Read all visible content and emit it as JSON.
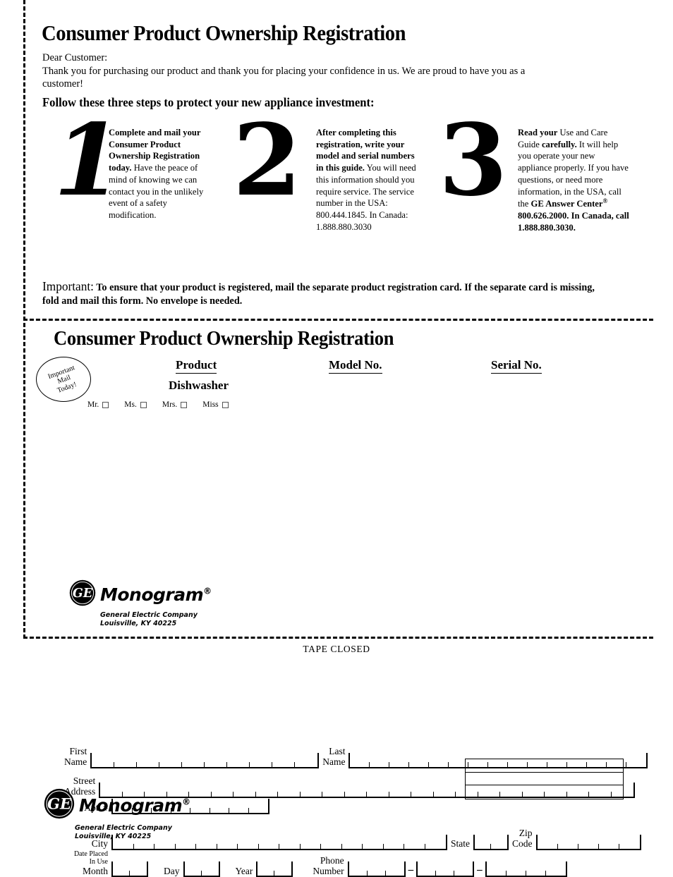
{
  "document": {
    "title": "Consumer Product Ownership Registration",
    "salutation": "Dear Customer:",
    "thank_you": "Thank you for purchasing our product and thank you for placing your confidence in us. We are proud to have you as a customer!",
    "follow_steps_heading": "Follow these three steps to protect your new appliance investment:"
  },
  "steps": [
    {
      "number": "1",
      "bold_text": "Complete and mail your Consumer Product Ownership Registration today.",
      "regular_text": "Have the peace of mind of knowing we can contact you in the unlikely event of a safety modification."
    },
    {
      "number": "2",
      "bold_text": "After completing this registration, write your model and serial numbers in this guide.",
      "regular_text": "You will need this information should you require service. The service number in the USA: 800.444.1845. In Canada: 1.888.880.3030"
    },
    {
      "number": "3",
      "bold_read": "Read your",
      "mid_text_1": " Use and Care Guide ",
      "bold_carefully": "carefully.",
      "mid_text_2": " It will help you operate your new appliance properly. If you have questions, or need more information, in the USA, call the ",
      "bold_answer_center": "GE Answer Center",
      "registered_mark": "®",
      "bold_tail": " 800.626.2000. In Canada, call 1.888.880.3030."
    }
  ],
  "important": {
    "label": "Important:",
    "text": "To ensure that your product is registered, mail the separate product registration card. If the separate card is missing, fold and mail this form. No envelope is needed."
  },
  "card": {
    "title": "Consumer Product Ownership Registration",
    "stamp": {
      "line1": "Important",
      "line2": "Mail",
      "line3": "Today!"
    },
    "headers": {
      "product": "Product",
      "model_no": "Model No.",
      "serial_no": "Serial No."
    },
    "product_value": "Dishwasher",
    "salutations": [
      {
        "label": "Mr.",
        "checked": false
      },
      {
        "label": "Ms.",
        "checked": false
      },
      {
        "label": "Mrs.",
        "checked": false
      },
      {
        "label": "Miss",
        "checked": false
      }
    ],
    "fields": {
      "first_name": {
        "label_line1": "First",
        "label_line2": "Name",
        "cells": 10,
        "value": ""
      },
      "last_name": {
        "label_line1": "Last",
        "label_line2": "Name",
        "cells": 15,
        "value": ""
      },
      "street_address": {
        "label_line1": "Street",
        "label_line2": "Address",
        "cells": 24,
        "value": ""
      },
      "apt_number": {
        "label": "Apt. #",
        "cells": 8,
        "value": ""
      },
      "city": {
        "label": "City",
        "cells": 16,
        "value": ""
      },
      "state": {
        "label": "State",
        "cells": 2,
        "value": ""
      },
      "zip_code": {
        "label_line1": "Zip",
        "label_line2": "Code",
        "cells": 5,
        "value": ""
      },
      "date_placed_in_use": {
        "label_line1": "Date Placed",
        "label_line2": "In Use",
        "label_line3": "Month",
        "month_cells": 2,
        "day_label": "Day",
        "day_cells": 2,
        "year_label": "Year",
        "year_cells": 2,
        "value": ""
      },
      "phone_number": {
        "label_line1": "Phone",
        "label_line2": "Number",
        "area_cells": 3,
        "prefix_cells": 3,
        "line_cells": 4,
        "separator": "–",
        "value": ""
      }
    }
  },
  "logo": {
    "monogram_word": "Monogram",
    "registered": "®",
    "company": "General Electric Company",
    "city_state_zip": "Louisville, KY 40225",
    "ge_initials": "GE"
  },
  "footer": {
    "tape_closed": "TAPE CLOSED",
    "boxes": [
      "",
      "",
      ""
    ]
  },
  "colors": {
    "ink": "#000000",
    "paper": "#ffffff",
    "checkbox_border": "#555555"
  }
}
